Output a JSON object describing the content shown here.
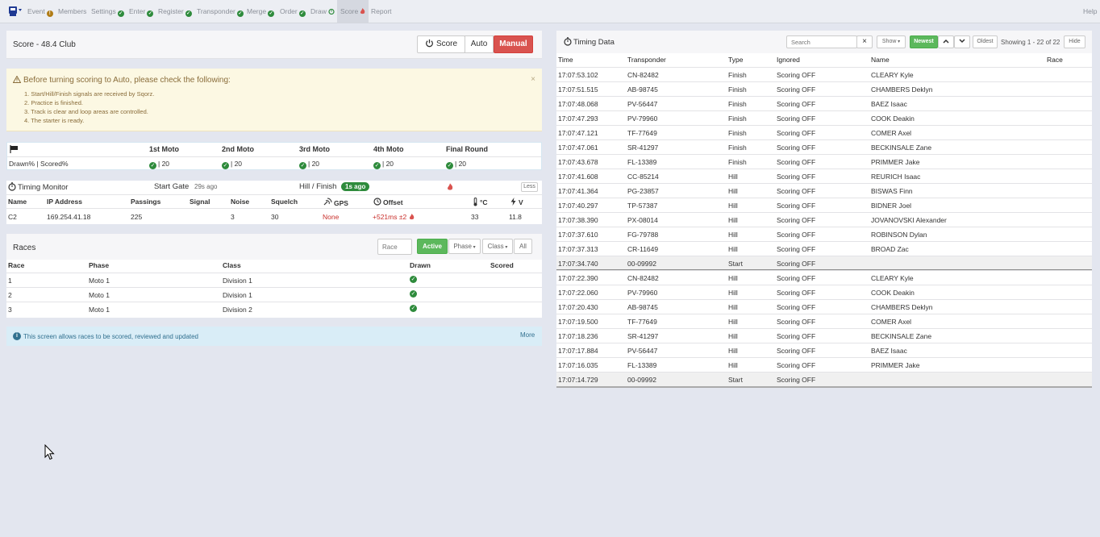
{
  "nav": {
    "items": [
      {
        "label": "Event",
        "status": "warn"
      },
      {
        "label": "Members",
        "status": ""
      },
      {
        "label": "Settings",
        "status": "check"
      },
      {
        "label": "Enter",
        "status": "check"
      },
      {
        "label": "Register",
        "status": "check"
      },
      {
        "label": "Transponder",
        "status": "check"
      },
      {
        "label": "Merge",
        "status": "check"
      },
      {
        "label": "Order",
        "status": "check"
      },
      {
        "label": "Draw",
        "status": "timer"
      },
      {
        "label": "Score",
        "status": "fire"
      },
      {
        "label": "Report",
        "status": ""
      }
    ],
    "help": "Help"
  },
  "score": {
    "title": "Score - 48.4 Club",
    "score_btn": "Score",
    "auto_btn": "Auto",
    "manual_btn": "Manual"
  },
  "warning": {
    "title": "Before turning scoring to Auto, please check the following:",
    "close": "×",
    "items": [
      "1. Start/Hill/Finish signals are received by Sqorz.",
      "2. Practice is finished.",
      "3. Track is clear and loop areas are controlled.",
      "4. The starter is ready."
    ]
  },
  "motos": {
    "headers": [
      "1st Moto",
      "2nd Moto",
      "3rd Moto",
      "4th Moto",
      "Final Round"
    ],
    "row_label": "Drawn% | Scored%",
    "values": [
      "| 20",
      "| 20",
      "| 20",
      "| 20",
      "| 20"
    ]
  },
  "monitor": {
    "title": "Timing Monitor",
    "start_gate_label": "Start Gate",
    "start_gate_value": "29s ago",
    "hill_label": "Hill / Finish",
    "hill_badge": "1s ago",
    "less_btn": "Less",
    "columns": [
      "Name",
      "IP Address",
      "Passings",
      "Signal",
      "Noise",
      "Squelch",
      "GPS",
      "Offset",
      "°C",
      "V"
    ],
    "row": [
      "C2",
      "169.254.41.18",
      "225",
      "",
      "3",
      "30",
      "None",
      "+521ms ±2",
      "33",
      "11.8"
    ]
  },
  "races": {
    "title": "Races",
    "race_placeholder": "Race",
    "filters": [
      "Active",
      "Phase",
      "Class",
      "All"
    ],
    "columns": [
      "Race",
      "Phase",
      "Class",
      "Drawn",
      "Scored"
    ],
    "rows": [
      {
        "race": "1",
        "phase": "Moto 1",
        "class": "Division 1"
      },
      {
        "race": "2",
        "phase": "Moto 1",
        "class": "Division 1"
      },
      {
        "race": "3",
        "phase": "Moto 1",
        "class": "Division 2"
      }
    ]
  },
  "info": {
    "text": "This screen allows races to be scored, reviewed and updated",
    "more": "More"
  },
  "timing": {
    "title": "Timing Data",
    "search_placeholder": "Search",
    "clear": "×",
    "show_btn": "Show",
    "newest_btn": "Newest",
    "oldest_btn": "Oldest",
    "showing": "Showing 1 - 22 of 22",
    "hide_btn": "Hide",
    "columns": [
      "Time",
      "Transponder",
      "Type",
      "Ignored",
      "Name",
      "Race"
    ],
    "rows": [
      {
        "time": "17:07:53.102",
        "tx": "CN-82482",
        "type": "Finish",
        "ignored": "Scoring OFF",
        "name": "CLEARY Kyle"
      },
      {
        "time": "17:07:51.515",
        "tx": "AB-98745",
        "type": "Finish",
        "ignored": "Scoring OFF",
        "name": "CHAMBERS Deklyn"
      },
      {
        "time": "17:07:48.068",
        "tx": "PV-56447",
        "type": "Finish",
        "ignored": "Scoring OFF",
        "name": "BAEZ Isaac"
      },
      {
        "time": "17:07:47.293",
        "tx": "PV-79960",
        "type": "Finish",
        "ignored": "Scoring OFF",
        "name": "COOK Deakin"
      },
      {
        "time": "17:07:47.121",
        "tx": "TF-77649",
        "type": "Finish",
        "ignored": "Scoring OFF",
        "name": "COMER Axel"
      },
      {
        "time": "17:07:47.061",
        "tx": "SR-41297",
        "type": "Finish",
        "ignored": "Scoring OFF",
        "name": "BECKINSALE Zane"
      },
      {
        "time": "17:07:43.678",
        "tx": "FL-13389",
        "type": "Finish",
        "ignored": "Scoring OFF",
        "name": "PRIMMER Jake"
      },
      {
        "time": "17:07:41.608",
        "tx": "CC-85214",
        "type": "Hill",
        "ignored": "Scoring OFF",
        "name": "REURICH Isaac"
      },
      {
        "time": "17:07:41.364",
        "tx": "PG-23857",
        "type": "Hill",
        "ignored": "Scoring OFF",
        "name": "BISWAS Finn"
      },
      {
        "time": "17:07:40.297",
        "tx": "TP-57387",
        "type": "Hill",
        "ignored": "Scoring OFF",
        "name": "BIDNER Joel"
      },
      {
        "time": "17:07:38.390",
        "tx": "PX-08014",
        "type": "Hill",
        "ignored": "Scoring OFF",
        "name": "JOVANOVSKI Alexander"
      },
      {
        "time": "17:07:37.610",
        "tx": "FG-79788",
        "type": "Hill",
        "ignored": "Scoring OFF",
        "name": "ROBINSON Dylan"
      },
      {
        "time": "17:07:37.313",
        "tx": "CR-11649",
        "type": "Hill",
        "ignored": "Scoring OFF",
        "name": "BROAD Zac"
      },
      {
        "time": "17:07:34.740",
        "tx": "00-09992",
        "type": "Start",
        "ignored": "Scoring OFF",
        "name": ""
      },
      {
        "time": "17:07:22.390",
        "tx": "CN-82482",
        "type": "Hill",
        "ignored": "Scoring OFF",
        "name": "CLEARY Kyle"
      },
      {
        "time": "17:07:22.060",
        "tx": "PV-79960",
        "type": "Hill",
        "ignored": "Scoring OFF",
        "name": "COOK Deakin"
      },
      {
        "time": "17:07:20.430",
        "tx": "AB-98745",
        "type": "Hill",
        "ignored": "Scoring OFF",
        "name": "CHAMBERS Deklyn"
      },
      {
        "time": "17:07:19.500",
        "tx": "TF-77649",
        "type": "Hill",
        "ignored": "Scoring OFF",
        "name": "COMER Axel"
      },
      {
        "time": "17:07:18.236",
        "tx": "SR-41297",
        "type": "Hill",
        "ignored": "Scoring OFF",
        "name": "BECKINSALE Zane"
      },
      {
        "time": "17:07:17.884",
        "tx": "PV-56447",
        "type": "Hill",
        "ignored": "Scoring OFF",
        "name": "BAEZ Isaac"
      },
      {
        "time": "17:07:16.035",
        "tx": "FL-13389",
        "type": "Hill",
        "ignored": "Scoring OFF",
        "name": "PRIMMER Jake"
      },
      {
        "time": "17:07:14.729",
        "tx": "00-09992",
        "type": "Start",
        "ignored": "Scoring OFF",
        "name": ""
      }
    ]
  },
  "colors": {
    "accent_green": "#5cb85c",
    "danger_red": "#d9534f",
    "check_green": "#2e8b3c"
  }
}
